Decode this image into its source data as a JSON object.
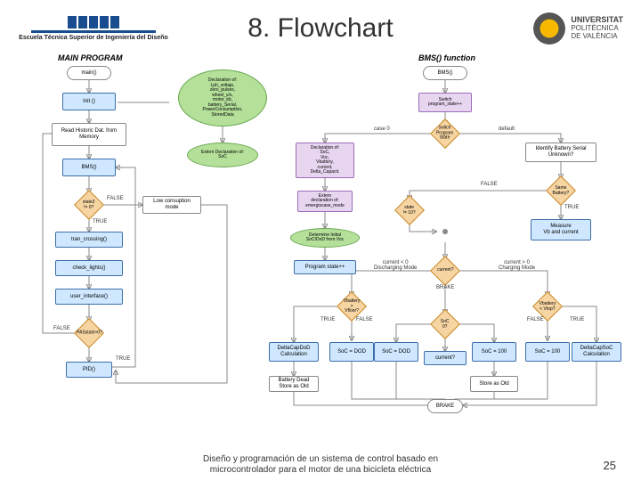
{
  "header": {
    "school_name": "Escuela Técnica Superior de Ingeniería del Diseño",
    "title": "8. Flowchart",
    "univ_line1": "UNIVERSITAT",
    "univ_line2": "POLITÈCNICA",
    "univ_line3": "DE VALÈNCIA"
  },
  "labels": {
    "main_program": "MAIN PROGRAM",
    "bms_function": "BMS() function",
    "true": "TRUE",
    "false": "FALSE",
    "case0": "case 0",
    "default": "default"
  },
  "main": {
    "start": "main()",
    "init": "Init ()",
    "read": "Read Historic Dat. from Memory",
    "bms": "BMS()",
    "dec_state": "state3 != 0?",
    "low": "Low consuption mode",
    "tran": "tran_crossing()",
    "check": "check_lights()",
    "user": "user_interface()",
    "dec_pas": "PASstate>0?",
    "pid": "PID()",
    "blob1": "Declaration of:\nI,ph_voltaje,\nzero_pulses,\nwheel_v/s,\nmotor_kb,\nbattery_Serial,\nPowerConsumption,\nStoredData",
    "blob2": "Extern Declaration of:\nSoC"
  },
  "bms": {
    "start": "BMS()",
    "switch_decl": "Switch\nprogram_state++",
    "switch": "switch Program State",
    "case0_decl": "Declaration of:\nSoC,\nVoc,\nVbattery,\ncurrent,\nDelta_Capacit.",
    "case0_ext": "Extern\ndeclaration of:\nemergiscase_mode",
    "init_socdod": "Determine Initial\nSoC/DoD from Voc",
    "inc": "Program state++",
    "identify": "Identify Battery Serial\nUnknown?",
    "same": "Same Battery?",
    "dec3": "state != 10?",
    "measure": "Measure\nVb and current",
    "dec_cur": "current?",
    "brake_label": "BRAKE",
    "cur_neg": "current < 0\nDischarging Mode",
    "cur_pos": "current > 0\nCharging Mode",
    "dec_vlow": "Vbattery > Vfloor?",
    "dec_soc": "SoC 0?",
    "dec_cur0": "current?",
    "dec_vhigh": "Vbattery < Vtop?",
    "deltaD": "DeltaCapDoD\nCalculation",
    "soc0": "SoC = DOD",
    "soc100": "SoC = 100",
    "deltaS": "DeltaCapSoC\nCalculation",
    "store1": "Battery Dead\nStore as Old",
    "store2": "Store as Old",
    "brake": "BRAKE"
  },
  "footer": {
    "line1": "Diseño y programación de un sistema de control basado en",
    "line2": "microcontrolador para el motor de una bicicleta eléctrica",
    "page": "25"
  }
}
